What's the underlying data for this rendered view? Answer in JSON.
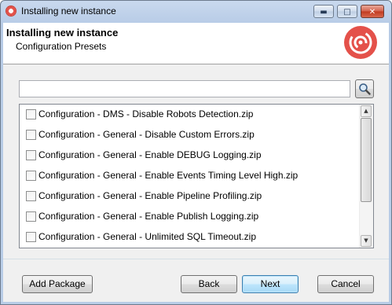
{
  "window": {
    "title": "Installing new instance"
  },
  "header": {
    "title": "Installing new instance",
    "subtitle": "Configuration Presets"
  },
  "search": {
    "value": "",
    "placeholder": ""
  },
  "presets": [
    {
      "label": "Configuration - DMS - Disable Robots Detection.zip",
      "checked": false
    },
    {
      "label": "Configuration - General - Disable Custom Errors.zip",
      "checked": false
    },
    {
      "label": "Configuration - General - Enable DEBUG Logging.zip",
      "checked": false
    },
    {
      "label": "Configuration - General - Enable Events Timing Level High.zip",
      "checked": false
    },
    {
      "label": "Configuration - General - Enable Pipeline Profiling.zip",
      "checked": false
    },
    {
      "label": "Configuration - General - Enable Publish Logging.zip",
      "checked": false
    },
    {
      "label": "Configuration - General - Unlimited SQL Timeout.zip",
      "checked": false
    }
  ],
  "buttons": {
    "add_package": "Add Package",
    "back": "Back",
    "next": "Next",
    "cancel": "Cancel"
  },
  "icons": {
    "app": "sitecore-logo-icon",
    "search": "magnifier-icon",
    "minimize": "minimize-icon",
    "maximize": "maximize-icon",
    "close": "close-icon"
  },
  "colors": {
    "brand_red": "#e4514a",
    "title_bar": "#c9d9ee",
    "default_button_border": "#3c7fb1"
  }
}
